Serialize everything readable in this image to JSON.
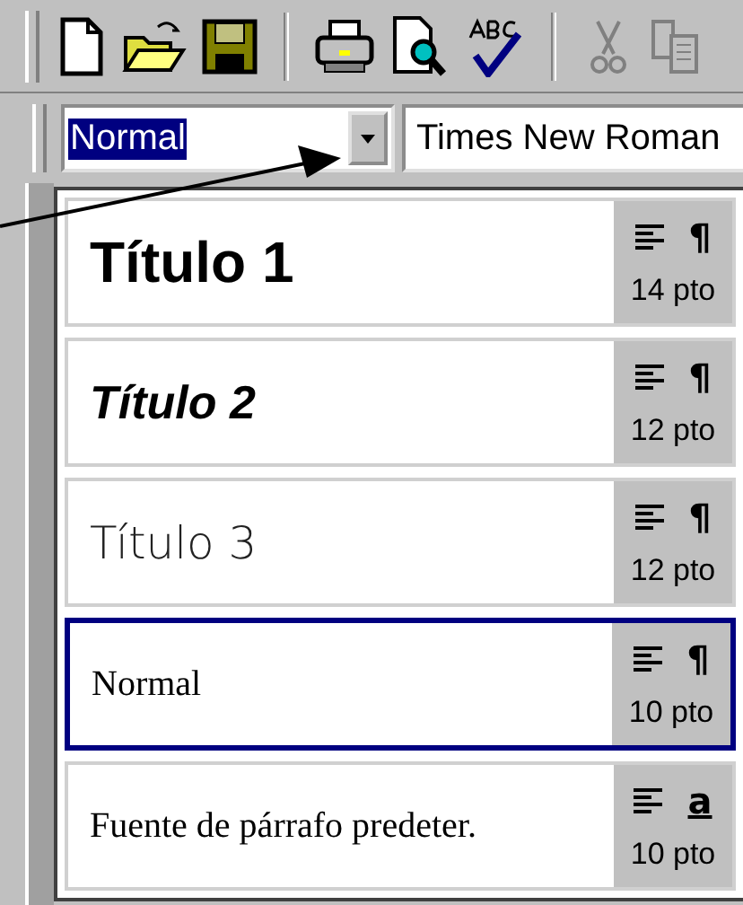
{
  "style_box": {
    "value": "Normal"
  },
  "font_box": {
    "value": "Times New Roman"
  },
  "styles": [
    {
      "name": "Título 1",
      "kind": "bold",
      "symbol": "¶",
      "underlined": false,
      "size": "14 pto",
      "selected": false
    },
    {
      "name": "Título 2",
      "kind": "bolditalic",
      "symbol": "¶",
      "underlined": false,
      "size": "12 pto",
      "selected": false
    },
    {
      "name": "Título 3",
      "kind": "plain",
      "symbol": "¶",
      "underlined": false,
      "size": "12 pto",
      "selected": false
    },
    {
      "name": "Normal",
      "kind": "serif",
      "symbol": "¶",
      "underlined": false,
      "size": "10 pto",
      "selected": true
    },
    {
      "name": "Fuente de párrafo predeter.",
      "kind": "serif",
      "symbol": "a",
      "underlined": true,
      "size": "10 pto",
      "selected": false
    }
  ]
}
